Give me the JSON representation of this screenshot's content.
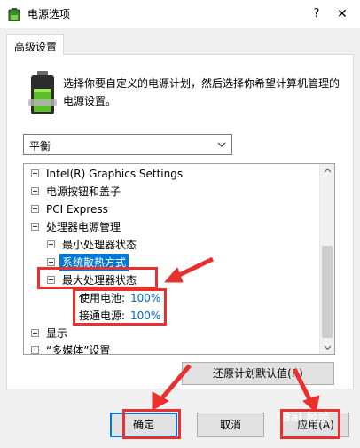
{
  "window": {
    "title": "电源选项",
    "help": "?",
    "close": "✕"
  },
  "tab": {
    "label": "高级设置"
  },
  "description": "选择你要自定义的电源计划，然后选择你希望计算机管理的电源设置。",
  "plan_select": {
    "value": "平衡"
  },
  "tree": {
    "items": [
      {
        "label": "Intel(R) Graphics Settings",
        "state": "collapsed"
      },
      {
        "label": "电源按钮和盖子",
        "state": "collapsed"
      },
      {
        "label": "PCI Express",
        "state": "collapsed"
      },
      {
        "label": "处理器电源管理",
        "state": "expanded"
      },
      {
        "label": "最小处理器状态",
        "state": "collapsed"
      },
      {
        "label": "系统散热方式",
        "state": "collapsed",
        "selected": true
      },
      {
        "label": "最大处理器状态",
        "state": "expanded"
      },
      {
        "label": "使用电池:",
        "value": "100%"
      },
      {
        "label": "接通电源:",
        "value": "100%"
      },
      {
        "label": "显示",
        "state": "collapsed"
      },
      {
        "label": "“多媒体”设置",
        "state": "collapsed"
      }
    ]
  },
  "buttons": {
    "restore": "还原计划默认值(R)",
    "ok": "确定",
    "cancel": "取消",
    "apply": "应用(A)"
  },
  "colors": {
    "annotation": "#e8302f",
    "selection": "#0078d7",
    "value_text": "#0066cc"
  },
  "watermark": "Bai 经验"
}
